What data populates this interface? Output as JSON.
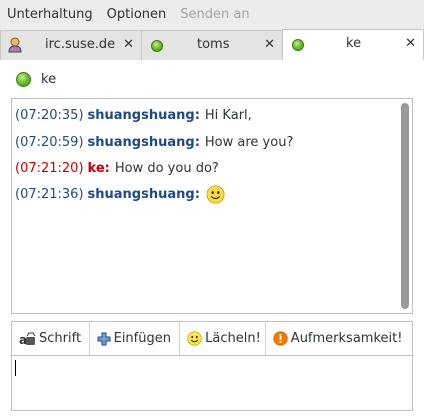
{
  "menubar": {
    "items": [
      {
        "label": "Unterhaltung",
        "enabled": true
      },
      {
        "label": "Optionen",
        "enabled": true
      },
      {
        "label": "Senden an",
        "enabled": false
      }
    ]
  },
  "tabs": [
    {
      "label": "irc.suse.de",
      "icon": "user-avatar-icon",
      "active": false
    },
    {
      "label": "toms",
      "icon": "status-available-icon",
      "active": false
    },
    {
      "label": "ke",
      "icon": "status-available-icon",
      "active": true
    }
  ],
  "close_glyph": "✕",
  "conversation": {
    "contact_name": "ke",
    "status_color": "#5fb52a",
    "messages": [
      {
        "timestamp": "(07:20:35)",
        "nick": "shuangshuang:",
        "text": "Hi Karl,",
        "direction": "in"
      },
      {
        "timestamp": "(07:20:59)",
        "nick": "shuangshuang:",
        "text": "How are you?",
        "direction": "in"
      },
      {
        "timestamp": "(07:21:20)",
        "nick": "ke:",
        "text": "How do you do?",
        "direction": "out"
      },
      {
        "timestamp": "(07:21:36)",
        "nick": "shuangshuang:",
        "text": "",
        "direction": "in",
        "smiley": "smiley-icon"
      }
    ]
  },
  "toolbar": {
    "font_label": "Schrift",
    "insert_label": "Einfügen",
    "smile_label": "Lächeln!",
    "attention_label": "Aufmerksamkeit!"
  },
  "colors": {
    "incoming": "#204a87",
    "outgoing": "#cc0000"
  }
}
